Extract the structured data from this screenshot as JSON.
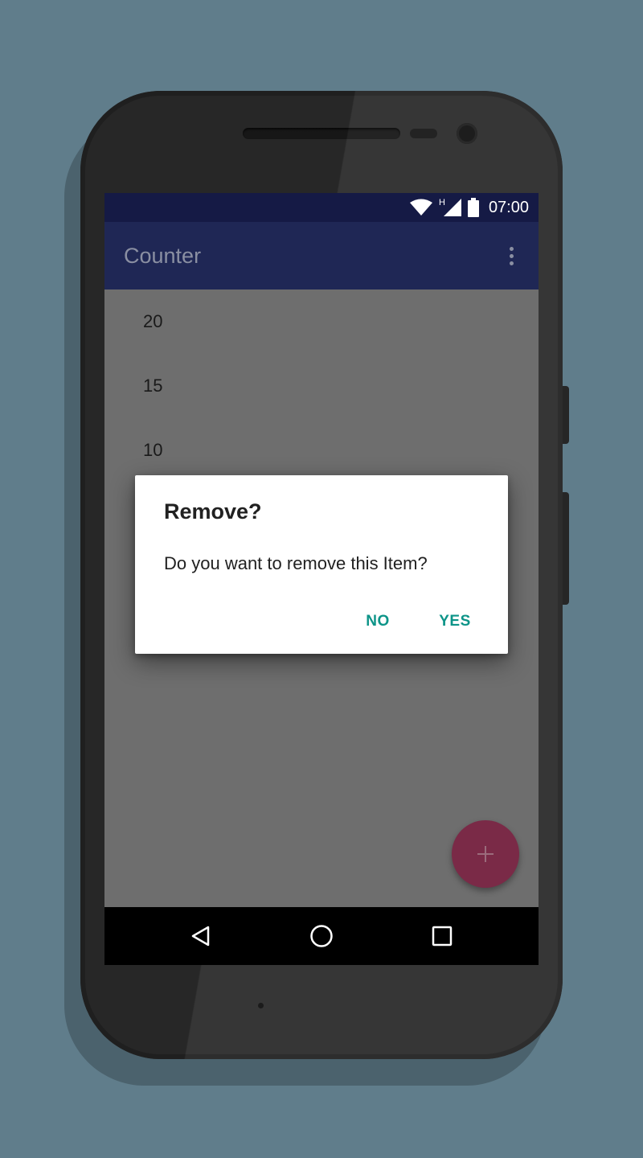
{
  "status_bar": {
    "time": "07:00",
    "network_label": "H",
    "icons": [
      "wifi-icon",
      "cell-signal-icon",
      "battery-icon"
    ]
  },
  "app_bar": {
    "title": "Counter",
    "menu_icon": "more-vert-icon"
  },
  "list": {
    "items": [
      "20",
      "15",
      "10"
    ]
  },
  "dialog": {
    "title": "Remove?",
    "message": "Do you want to remove this Item?",
    "negative_label": "NO",
    "positive_label": "YES",
    "accent_color": "#0d9488"
  },
  "fab": {
    "icon": "plus-icon",
    "color": "#7a2a47"
  },
  "nav_bar": {
    "icons": [
      "back-icon",
      "home-icon",
      "recents-icon"
    ]
  },
  "colors": {
    "background": "#607d8b",
    "status_bar": "#151a45",
    "app_bar": "#1f2755",
    "scrim_content": "#6e6e6e"
  }
}
